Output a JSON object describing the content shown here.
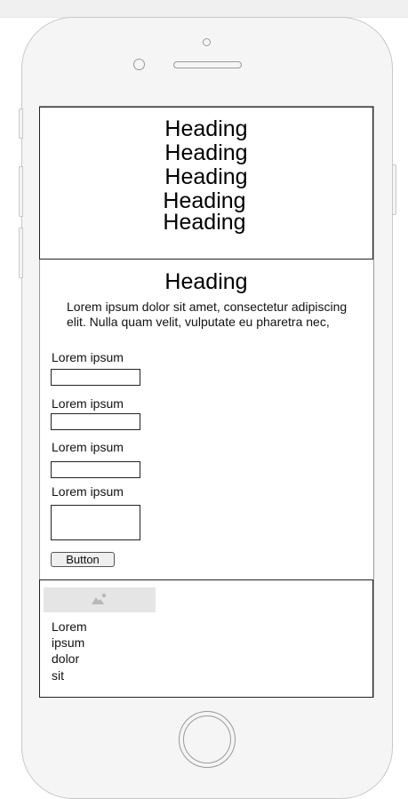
{
  "hero": {
    "headings": [
      "Heading",
      "Heading",
      "Heading",
      "Heading",
      "Heading"
    ]
  },
  "content": {
    "heading": "Heading",
    "paragraph": "Lorem ipsum dolor sit amet, consectetur adipiscing elit. Nulla quam velit, vulputate eu pharetra nec,"
  },
  "form": {
    "fields": [
      {
        "label": "Lorem ipsum",
        "value": ""
      },
      {
        "label": "Lorem ipsum",
        "value": ""
      },
      {
        "label": "Lorem ipsum",
        "value": ""
      },
      {
        "label": "Lorem ipsum",
        "value": ""
      }
    ],
    "button_label": "Button"
  },
  "card": {
    "image_icon": "image-placeholder-icon",
    "words": [
      "Lorem",
      "ipsum",
      "dolor",
      "sit"
    ]
  },
  "colors": {
    "phone_body": "#f5f5f5",
    "phone_outline": "#c8c8c8",
    "screen": "#ffffff",
    "border": "#222222",
    "image_placeholder": "#e5e5e5"
  }
}
